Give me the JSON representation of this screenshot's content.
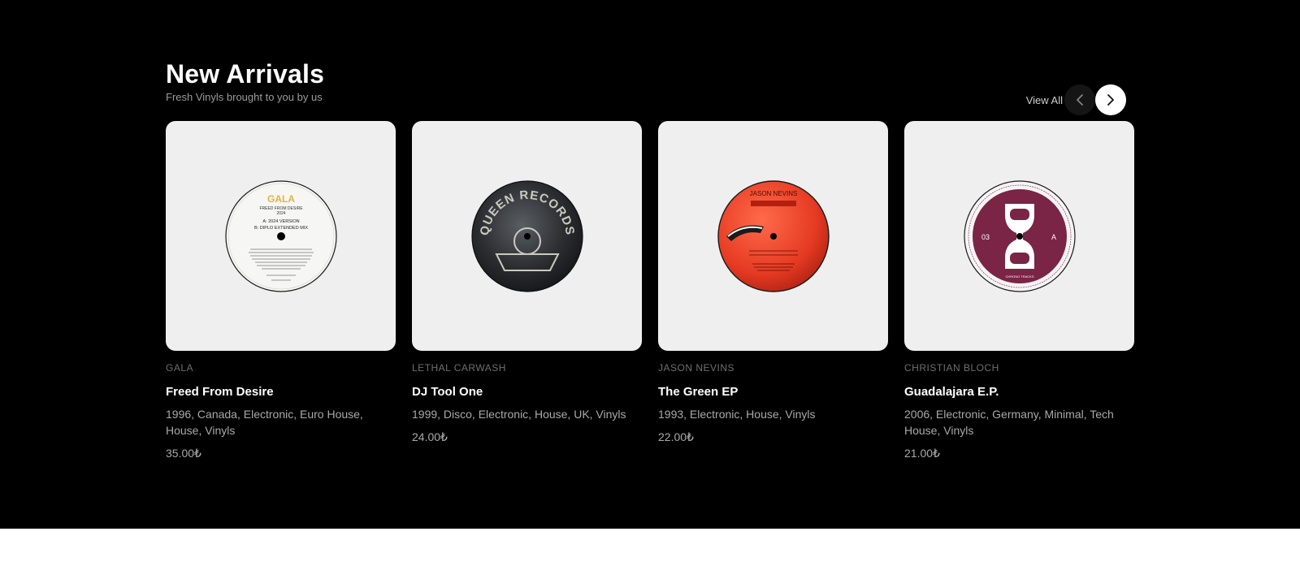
{
  "section": {
    "title": "New Arrivals",
    "subtitle": "Fresh Vinyls brought to you by us",
    "view_all": "View All"
  },
  "icons": {
    "prev": "chevron-left-icon",
    "next": "chevron-right-icon"
  },
  "products": [
    {
      "artist": "GALA",
      "name": "Freed From Desire",
      "tags": "1996, Canada, Electronic, Euro House, House, Vinyls",
      "price": "35.00₺",
      "label_lines": [
        "GALA",
        "FREED FROM DESIRE",
        "2024",
        "A: 2024 VERSION",
        "B: DIPLO EXTENDED MIX"
      ],
      "label_color": "#f6f6f4"
    },
    {
      "artist": "LETHAL CARWASH",
      "name": "DJ Tool One",
      "tags": "1999, Disco, Electronic, House, UK, Vinyls",
      "price": "24.00₺",
      "label_lines": [
        "QUEEN RECORDS"
      ],
      "label_color": "#2a2c30"
    },
    {
      "artist": "JASON NEVINS",
      "name": "The Green EP",
      "tags": "1993, Electronic, House, Vinyls",
      "price": "22.00₺",
      "label_lines": [
        "JASON NEVINS"
      ],
      "label_color": "#e53a22"
    },
    {
      "artist": "CHRISTIAN BLOCH",
      "name": "Guadalajara E.P.",
      "tags": "2006, Electronic, Germany, Minimal, Tech House, Vinyls",
      "price": "21.00₺",
      "label_lines": [
        "03",
        "A",
        "CHRONO TRACKS"
      ],
      "label_color": "#7a2446"
    }
  ]
}
